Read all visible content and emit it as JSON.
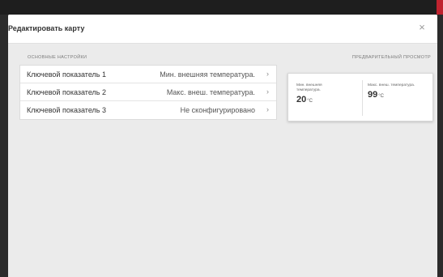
{
  "modal": {
    "title": "Редактировать карту",
    "close_symbol": "×"
  },
  "sections": {
    "settings_label": "ОСНОВНЫЕ НАСТРОЙКИ",
    "preview_label": "ПРЕДВАРИТЕЛЬНЫЙ ПРОСМОТР"
  },
  "settings": {
    "rows": [
      {
        "name": "Ключевой показатель 1",
        "value": "Мин. внешняя температура.",
        "chevron": "›"
      },
      {
        "name": "Ключевой показатель 2",
        "value": "Макс. внеш. температура.",
        "chevron": "›"
      },
      {
        "name": "Ключевой показатель 3",
        "value": "Не сконфигурировано",
        "chevron": "›"
      }
    ]
  },
  "preview": {
    "kpis": [
      {
        "label": "Мин. внешняя температура.",
        "value": "20",
        "unit": "°C"
      },
      {
        "label": "Макс. внеш. температура.",
        "value": "99",
        "unit": "°C"
      }
    ]
  },
  "colors": {
    "backdrop": "#2b2b2b",
    "topbar_accent": "#c0232f",
    "modal_body": "#ebebeb",
    "card_bg": "#ffffff"
  },
  "icons": {
    "close": "close-icon",
    "row_chevron": "chevron-right-icon"
  }
}
